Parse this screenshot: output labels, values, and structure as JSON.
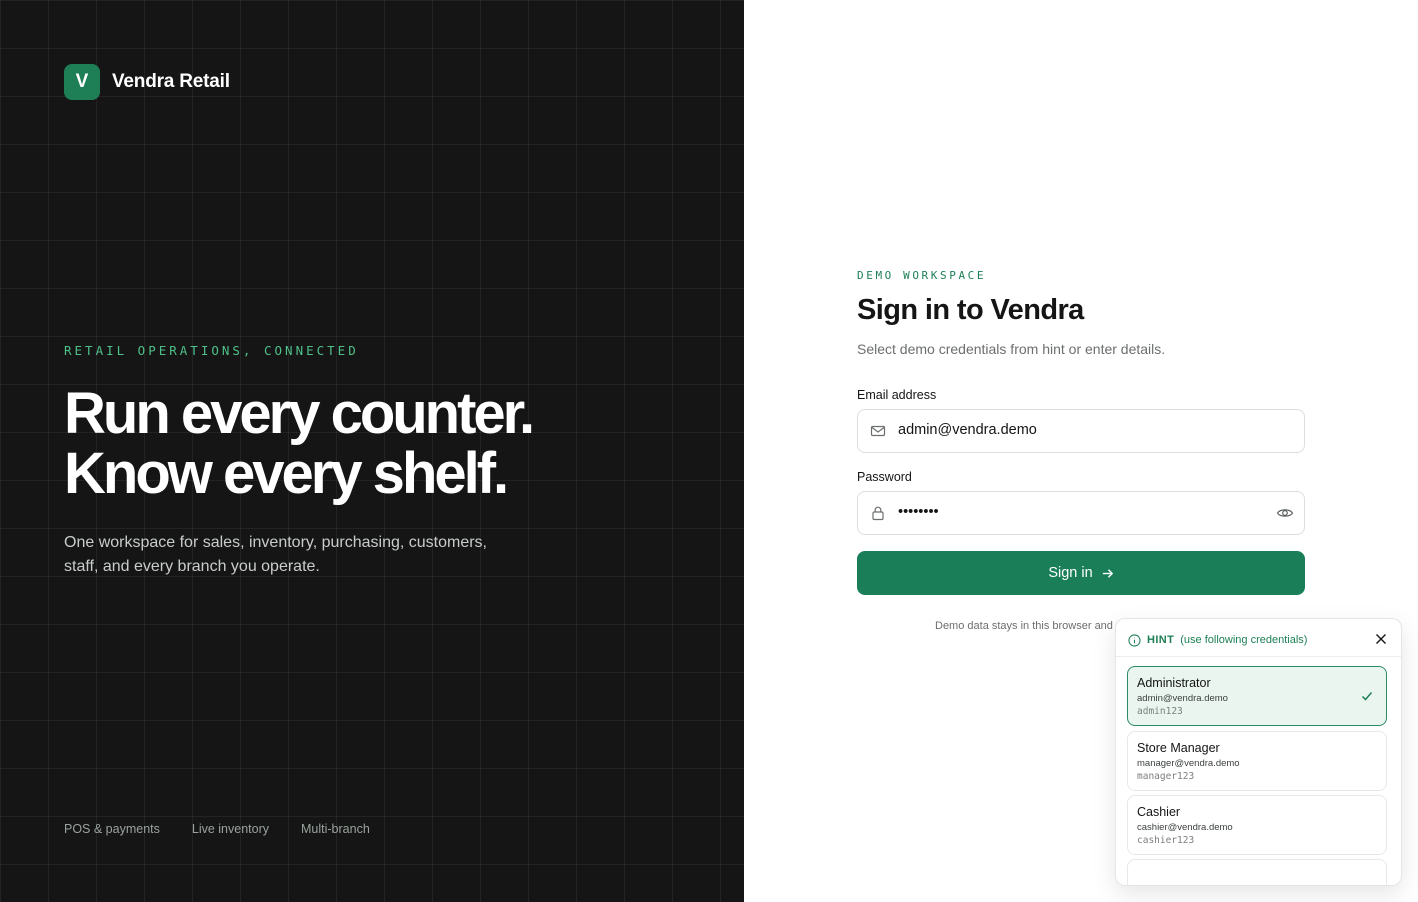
{
  "brand": {
    "mark": "V",
    "name": "Vendra Retail"
  },
  "hero": {
    "eyebrow": "RETAIL OPERATIONS, CONNECTED",
    "line1": "Run every counter.",
    "line2": "Know every shelf.",
    "lede": "One workspace for sales, inventory, purchasing, customers, staff, and every branch you operate."
  },
  "features": [
    "POS & payments",
    "Live inventory",
    "Multi-branch"
  ],
  "signin": {
    "eyebrow": "DEMO WORKSPACE",
    "title": "Sign in to Vendra",
    "subtitle": "Select demo credentials from hint or enter details.",
    "email_label": "Email address",
    "email_value": "admin@vendra.demo",
    "password_label": "Password",
    "password_masked": "••••••••",
    "button_label": "Sign in",
    "footnote": "Demo data stays in this browser and"
  },
  "hint": {
    "label": "HINT",
    "note": "(use following credentials)",
    "credentials": [
      {
        "role": "Administrator",
        "email": "admin@vendra.demo",
        "password": "admin123",
        "selected": true
      },
      {
        "role": "Store Manager",
        "email": "manager@vendra.demo",
        "password": "manager123",
        "selected": false
      },
      {
        "role": "Cashier",
        "email": "cashier@vendra.demo",
        "password": "cashier123",
        "selected": false
      }
    ]
  },
  "colors": {
    "accent": "#1e7f57",
    "dark_bg": "#141514"
  },
  "icons": {
    "email": "mail-icon",
    "password": "lock-icon",
    "reveal": "eye-icon",
    "submit": "arrow-right-icon",
    "hint": "info-icon",
    "close": "close-icon",
    "selected": "check-icon"
  }
}
